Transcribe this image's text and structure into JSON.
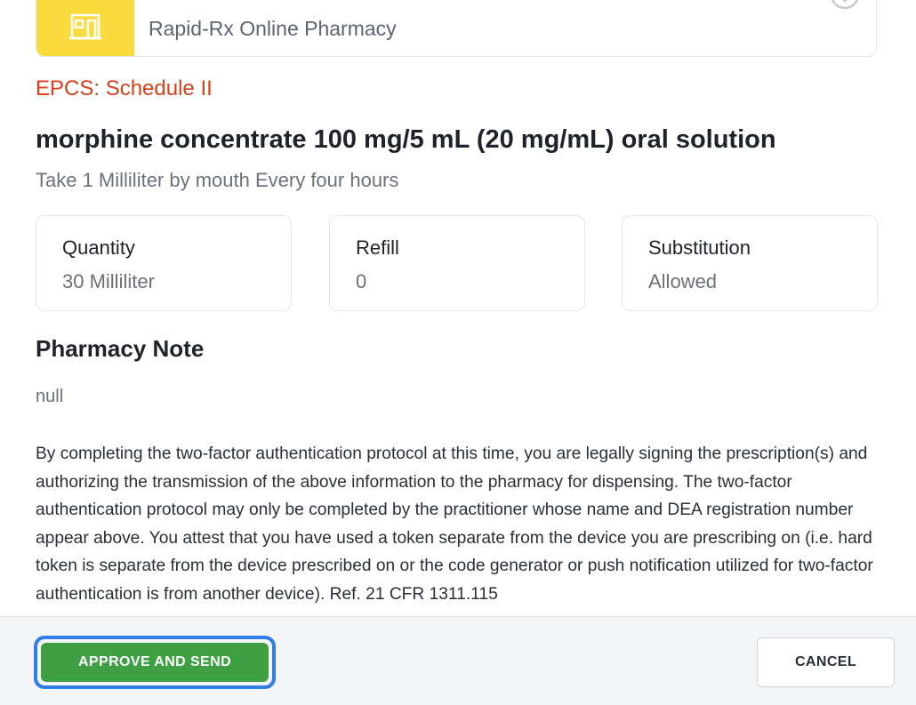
{
  "pharmacy": {
    "name": "Rapid-Rx Online Pharmacy",
    "icon": "pharmacy-store-icon",
    "accent_color": "#fadb3e"
  },
  "prescription": {
    "schedule_label": "EPCS: Schedule II",
    "drug_name": "morphine concentrate 100 mg/5 mL (20 mg/mL) oral solution",
    "sig": "Take 1 Milliliter by mouth Every four hours",
    "details": [
      {
        "label": "Quantity",
        "value": "30 Milliliter"
      },
      {
        "label": "Refill",
        "value": "0"
      },
      {
        "label": "Substitution",
        "value": "Allowed"
      }
    ]
  },
  "pharmacy_note": {
    "title": "Pharmacy Note",
    "value": "null"
  },
  "attestation": "By completing the two-factor authentication protocol at this time, you are legally signing the prescription(s) and authorizing the transmission of the above information to the pharmacy for dispensing. The two-factor authentication protocol may only be completed by the practitioner whose name and DEA registration number appear above. You attest that you have used a token separate from the device you are prescribing on (i.e. hard token is separate from the device prescribed on or the code generator or push notification utilized for two-factor authentication is from another device). Ref. 21 CFR 1311.115",
  "footer": {
    "approve_label": "APPROVE AND SEND",
    "cancel_label": "CANCEL"
  },
  "colors": {
    "schedule_red": "#d4421b",
    "approve_green": "#3ea043",
    "focus_blue": "#2f7ee6"
  }
}
